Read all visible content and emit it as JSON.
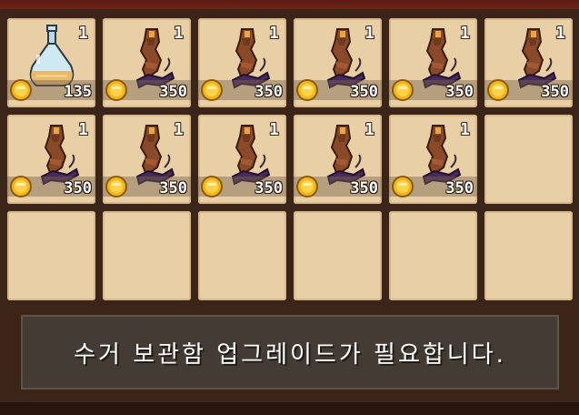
{
  "inventory": {
    "slots": [
      {
        "item": "potion-flask",
        "qty": "1",
        "price": "135"
      },
      {
        "item": "wooden-idol",
        "qty": "1",
        "price": "350"
      },
      {
        "item": "wooden-idol",
        "qty": "1",
        "price": "350"
      },
      {
        "item": "wooden-idol",
        "qty": "1",
        "price": "350"
      },
      {
        "item": "wooden-idol",
        "qty": "1",
        "price": "350"
      },
      {
        "item": "wooden-idol",
        "qty": "1",
        "price": "350"
      },
      {
        "item": "wooden-idol",
        "qty": "1",
        "price": "350"
      },
      {
        "item": "wooden-idol",
        "qty": "1",
        "price": "350"
      },
      {
        "item": "wooden-idol",
        "qty": "1",
        "price": "350"
      },
      {
        "item": "wooden-idol",
        "qty": "1",
        "price": "350"
      },
      {
        "item": "wooden-idol",
        "qty": "1",
        "price": "350"
      }
    ],
    "total_slots": 18
  },
  "icons": {
    "coin": "gold-coin-icon",
    "potion": "potion-flask-icon",
    "idol": "wooden-idol-icon"
  },
  "notice": {
    "message": "수거 보관함 업그레이드가 필요합니다."
  },
  "colors": {
    "slot_bg": "#e8cfa6",
    "frame": "#3b2418",
    "coin": "#f2b51e",
    "notice_bg": "#46403a"
  }
}
